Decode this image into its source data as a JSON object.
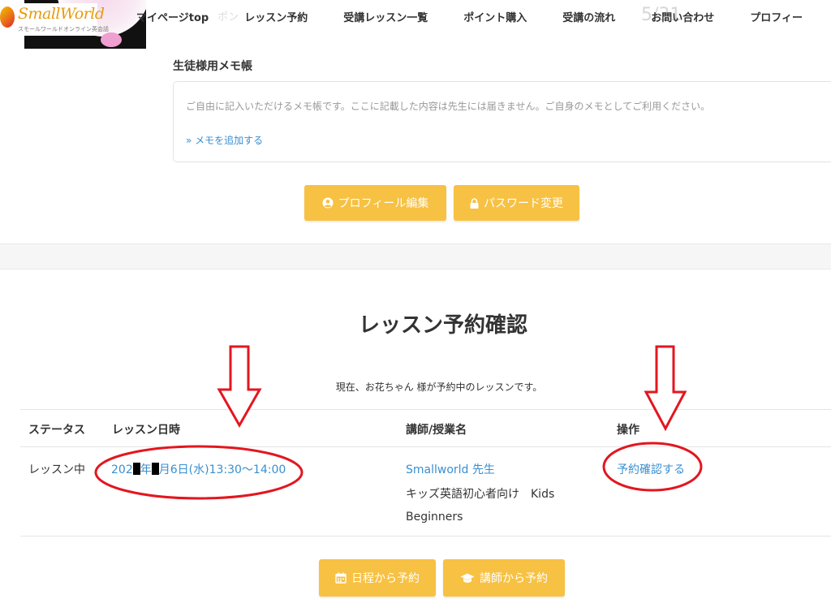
{
  "header": {
    "logo_text": "SmallWorld",
    "logo_sub": "スモールワールドオンライン英会話",
    "ghost_1": "ポン",
    "ghost_2": "5/31",
    "nav": [
      {
        "label": "マイページtop"
      },
      {
        "label": "レッスン予約"
      },
      {
        "label": "受講レッスン一覧"
      },
      {
        "label": "ポイント購入"
      },
      {
        "label": "受講の流れ"
      },
      {
        "label": "お問い合わせ"
      },
      {
        "label": "プロフィー"
      }
    ]
  },
  "memo": {
    "title": "生徒様用メモ帳",
    "description": "ご自由に記入いただけるメモ帳です。ここに記載した内容は先生には届きません。ご自身のメモとしてご利用ください。",
    "add_link": "» メモを追加する"
  },
  "profile_buttons": {
    "edit_profile": "プロフィール編集",
    "change_password": "パスワード変更"
  },
  "reservation": {
    "title": "レッスン予約確認",
    "intro": "現在、お花ちゃん 様が予約中のレッスンです。",
    "columns": [
      "ステータス",
      "レッスン日時",
      "講師/授業名",
      "操作"
    ],
    "rows": [
      {
        "status": "レッスン中",
        "datetime_prefix": "202",
        "datetime_mid": "年",
        "datetime_suffix": "月6日(水)13:30〜14:00",
        "teacher": "Smallworld 先生",
        "class_name_1": "キッズ英語初心者向け　Kids",
        "class_name_2": "Beginners",
        "action": "予約確認する"
      }
    ]
  },
  "bottom_buttons": {
    "by_schedule": "日程から予約",
    "by_teacher": "講師から予約"
  },
  "colors": {
    "accent_button": "#f7c143",
    "link": "#3a8fd0",
    "annotation_red": "#e3161f"
  }
}
